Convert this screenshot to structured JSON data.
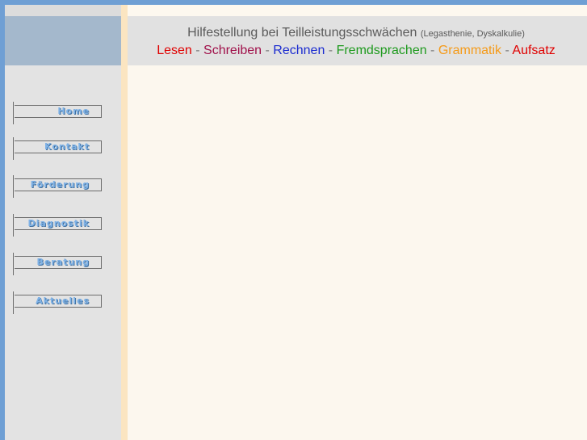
{
  "header": {
    "title": "Hilfestellung bei Teilleistungsschwächen",
    "subtitle": "(Legasthenie, Dyskalkulie)",
    "separator": " - ",
    "subjects": [
      {
        "label": "Lesen",
        "color": "#e00000"
      },
      {
        "label": "Schreiben",
        "color": "#a0104a"
      },
      {
        "label": "Rechnen",
        "color": "#1a2bd0"
      },
      {
        "label": "Fremdsprachen",
        "color": "#1e9a1e"
      },
      {
        "label": "Grammatik",
        "color": "#f59b1a"
      },
      {
        "label": "Aufsatz",
        "color": "#e00000"
      }
    ]
  },
  "nav": {
    "items": [
      "Home",
      "Kontakt",
      "Förderung",
      "Diagnostik",
      "Beratung",
      "Aktuelles"
    ]
  },
  "colors": {
    "accent": "#6f9fd4",
    "sidebar": "#e3e3e3",
    "sidebar_head": "#a4b8cc",
    "separator": "#fbe5c1",
    "background": "#fcf7ee",
    "nav_text": "#7fb2e6"
  }
}
